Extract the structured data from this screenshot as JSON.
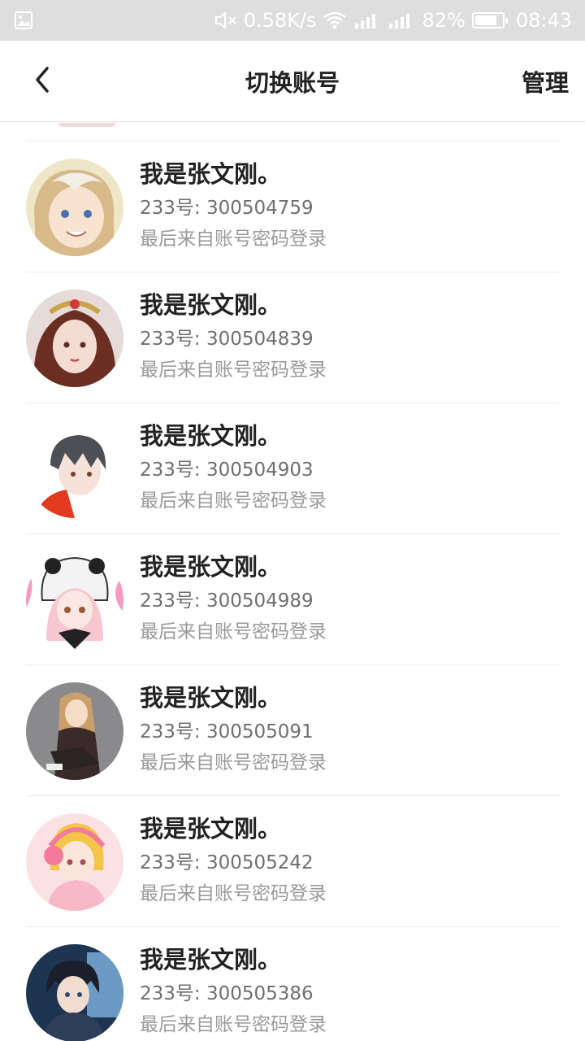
{
  "status_bar": {
    "speed": "0.58K/s",
    "battery_percent": "82%",
    "battery_level": 0.82,
    "time": "08:43",
    "icons": [
      "image-icon",
      "mute-icon",
      "wifi-icon",
      "signal-icon",
      "signal-icon",
      "battery-icon"
    ]
  },
  "header": {
    "title": "切换账号",
    "manage_label": "管理",
    "back_icon": "chevron-left-icon"
  },
  "accounts": [
    {
      "name": "我是张文刚。",
      "uid": "233号: 300504759",
      "login_note": "最后来自账号密码登录"
    },
    {
      "name": "我是张文刚。",
      "uid": "233号: 300504839",
      "login_note": "最后来自账号密码登录"
    },
    {
      "name": "我是张文刚。",
      "uid": "233号: 300504903",
      "login_note": "最后来自账号密码登录"
    },
    {
      "name": "我是张文刚。",
      "uid": "233号: 300504989",
      "login_note": "最后来自账号密码登录"
    },
    {
      "name": "我是张文刚。",
      "uid": "233号: 300505091",
      "login_note": "最后来自账号密码登录"
    },
    {
      "name": "我是张文刚。",
      "uid": "233号: 300505242",
      "login_note": "最后来自账号密码登录"
    },
    {
      "name": "我是张文刚。",
      "uid": "233号: 300505386",
      "login_note": "最后来自账号密码登录"
    }
  ],
  "colors": {
    "status_bar_bg": "#dedede",
    "title_text": "#222222",
    "secondary_text": "#6f6f6f",
    "tertiary_text": "#9a9a9a",
    "divider": "#ebebeb"
  }
}
